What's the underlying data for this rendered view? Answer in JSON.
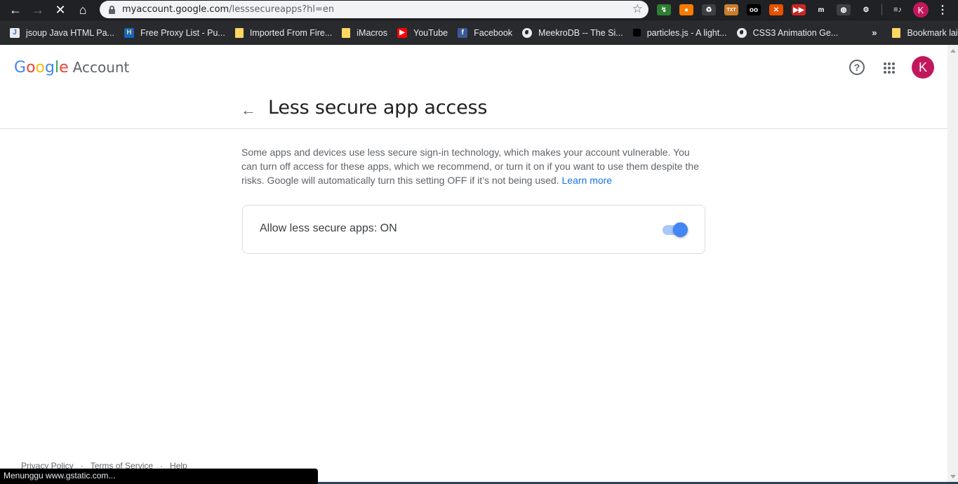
{
  "browser": {
    "url_host": "myaccount.google.com",
    "url_path": "/lesssecureapps?hl=en",
    "profile_initial": "K",
    "extensions": [
      {
        "name": "idm-icon",
        "color": "#2e7d32",
        "glyph": "↯"
      },
      {
        "name": "puzzle-ext-icon",
        "color": "#f57c00",
        "glyph": "●"
      },
      {
        "name": "recycle-icon",
        "color": "#3c4043",
        "glyph": "♻"
      },
      {
        "name": "cookie-txt-icon",
        "color": "#c97d2e",
        "glyph": "TXT"
      },
      {
        "name": "oo-ext-icon",
        "color": "#000000",
        "glyph": "oo"
      },
      {
        "name": "cross-ext-icon",
        "color": "#e65100",
        "glyph": "✕"
      },
      {
        "name": "forward-ext-icon",
        "color": "#c62828",
        "glyph": "▶▶"
      },
      {
        "name": "m-ext-icon",
        "color": "#202124",
        "glyph": "m"
      },
      {
        "name": "bucket-ext-icon",
        "color": "#3c4043",
        "glyph": "◍"
      },
      {
        "name": "gear-ext-icon",
        "color": "#202124",
        "glyph": "⚙"
      }
    ],
    "bookmarks": [
      {
        "label": "jsoup Java HTML Pa...",
        "icon": "jsoup-icon",
        "glyph": "J",
        "bg": "#e8eaed",
        "fg": "#3367d6"
      },
      {
        "label": "Free Proxy List - Pu...",
        "icon": "proxy-h-icon",
        "glyph": "H",
        "bg": "#1565c0",
        "fg": "#fdd663"
      },
      {
        "label": "Imported From Fire...",
        "icon": "folder-icon",
        "glyph": "",
        "bg": "",
        "fg": ""
      },
      {
        "label": "iMacros",
        "icon": "folder-icon",
        "glyph": "",
        "bg": "",
        "fg": ""
      },
      {
        "label": "YouTube",
        "icon": "youtube-icon",
        "glyph": "▶",
        "bg": "#ff0000",
        "fg": "#ffffff"
      },
      {
        "label": "Facebook",
        "icon": "facebook-icon",
        "glyph": "f",
        "bg": "#3b5998",
        "fg": "#ffffff"
      },
      {
        "label": "MeekroDB -- The Si...",
        "icon": "globe-icon",
        "glyph": "",
        "bg": "",
        "fg": ""
      },
      {
        "label": "particles.js - A light...",
        "icon": "particles-icon",
        "glyph": "",
        "bg": "#000000",
        "fg": ""
      },
      {
        "label": "CSS3 Animation Ge...",
        "icon": "globe-icon",
        "glyph": "",
        "bg": "",
        "fg": ""
      }
    ],
    "more_bookmarks": "»",
    "other_bookmarks": "Bookmark lain",
    "status_text": "Menunggu www.gstatic.com..."
  },
  "header": {
    "logo_letters": [
      {
        "ch": "G",
        "color": "#4285f4"
      },
      {
        "ch": "o",
        "color": "#ea4335"
      },
      {
        "ch": "o",
        "color": "#fbbc05"
      },
      {
        "ch": "g",
        "color": "#4285f4"
      },
      {
        "ch": "l",
        "color": "#34a853"
      },
      {
        "ch": "e",
        "color": "#ea4335"
      }
    ],
    "logo_suffix": "Account",
    "help_glyph": "?",
    "avatar_initial": "K",
    "avatar_color": "#c2185b"
  },
  "main": {
    "title": "Less secure app access",
    "description": "Some apps and devices use less secure sign-in technology, which makes your account vulnerable. You can turn off access for these apps, which we recommend, or turn it on if you want to use them despite the risks. Google will automatically turn this setting OFF if it’s not being used.",
    "learn_more": "Learn more",
    "setting_label": "Allow less secure apps: ON",
    "setting_on": true
  },
  "footer": {
    "links": [
      "Privacy Policy",
      "Terms of Service",
      "Help"
    ]
  }
}
